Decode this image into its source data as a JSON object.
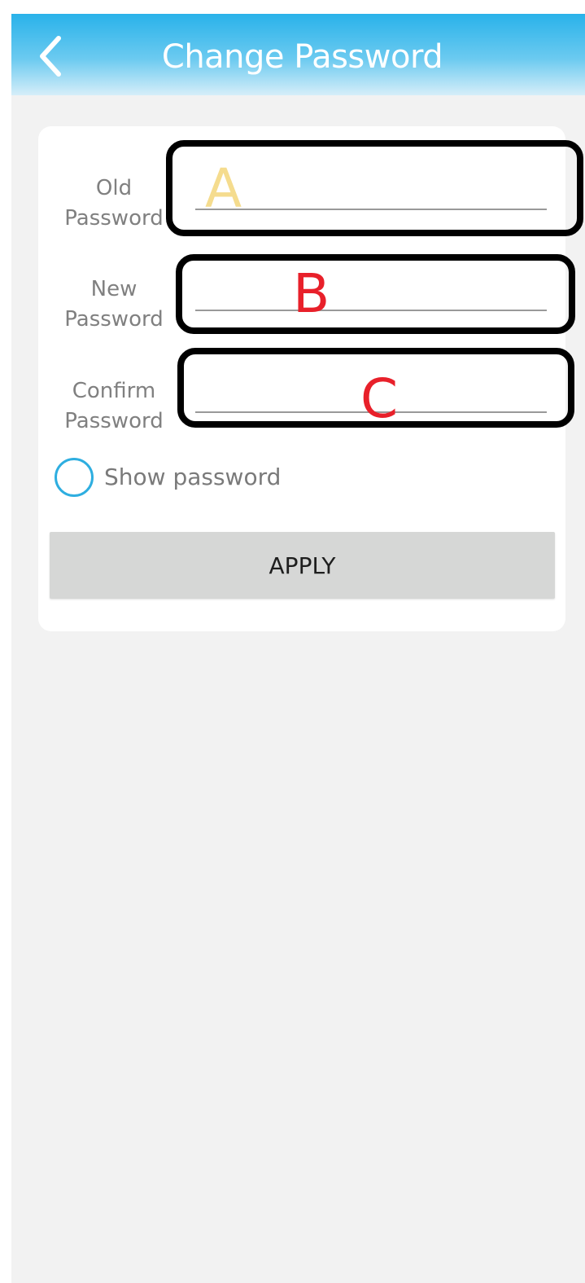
{
  "header": {
    "title": "Change Password",
    "back_icon": "chevron-left-icon",
    "gradient_top": "#29b2ea",
    "gradient_bottom": "#d6eef9"
  },
  "form": {
    "fields": [
      {
        "label": "Old\nPassword",
        "value": "",
        "annotation": "A",
        "annotation_color": "#f5dc8e"
      },
      {
        "label": "New\nPassword",
        "value": "",
        "annotation": "B",
        "annotation_color": "#e8202a"
      },
      {
        "label": "Confirm\nPassword",
        "value": "",
        "annotation": "C",
        "annotation_color": "#e8202a"
      }
    ],
    "show_password": {
      "label": "Show password",
      "checked": false,
      "ring_color": "#2eaee0"
    },
    "apply_label": "APPLY"
  },
  "colors": {
    "background": "#f2f2f2",
    "card": "#ffffff",
    "annotation_border": "#000000"
  }
}
